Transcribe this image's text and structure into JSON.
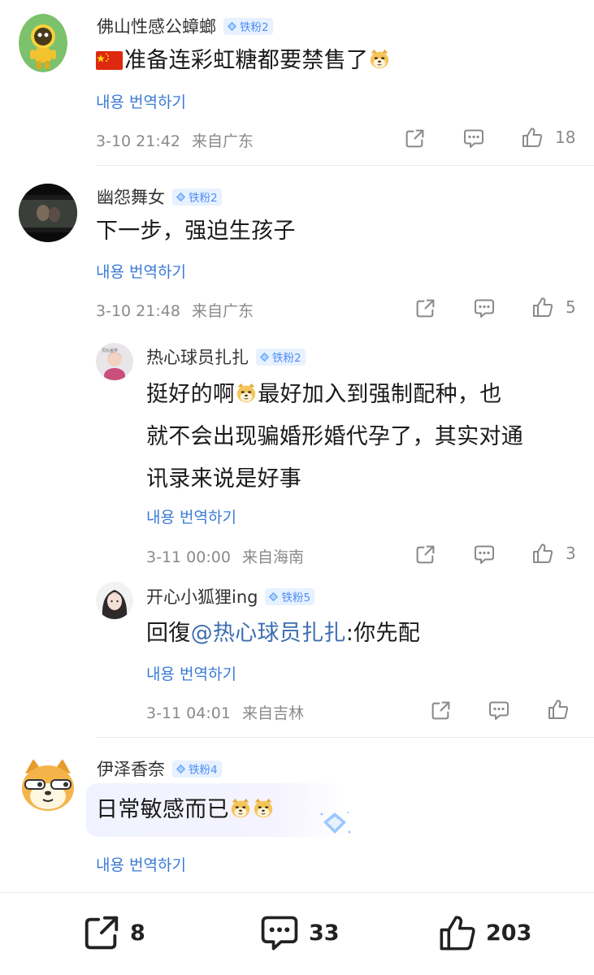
{
  "translate_label": "내용 번역하기",
  "comments": [
    {
      "username": "佛山性感公蟑螂",
      "badge": "铁粉2",
      "text": "准备连彩虹糖都要禁售了",
      "flag_icon": "china-flag-icon",
      "emoji": "doge-emoji",
      "date": "3-10 21:42",
      "location": "来自广东",
      "likes": "18"
    },
    {
      "username": "幽怨舞女",
      "badge": "铁粉2",
      "text": "下一步，强迫生孩子",
      "date": "3-10 21:48",
      "location": "来自广东",
      "likes": "5",
      "replies": [
        {
          "username": "热心球员扎扎",
          "badge": "铁粉2",
          "avatar_caption": "贝比盖罗",
          "text_part1": "挺好的啊",
          "text_part2": "最好加入到强制配种，也",
          "text_line2": "就不会出现骗婚形婚代孕了，其实对通",
          "text_line3": "讯录来说是好事",
          "emoji": "doge-emoji",
          "date": "3-11 00:00",
          "location": "来自海南",
          "likes": "3"
        },
        {
          "username": "开心小狐狸ing",
          "badge": "铁粉5",
          "reply_prefix": "回復",
          "mention": "@热心球员扎扎",
          "text": ":你先配",
          "date": "3-11 04:01",
          "location": "来自吉林",
          "likes": ""
        }
      ]
    },
    {
      "username": "伊泽香奈",
      "badge": "铁粉4",
      "text": "日常敏感而已",
      "emoji": "doge-emoji",
      "emoji_count": 2
    }
  ],
  "bottom_bar": {
    "share_count": "8",
    "comment_count": "33",
    "like_count": "203"
  },
  "colors": {
    "accent": "#3a7bd5",
    "badge_bg": "#e7f1ff",
    "badge_text": "#4f8ff5",
    "mention": "#3c6fb0"
  }
}
